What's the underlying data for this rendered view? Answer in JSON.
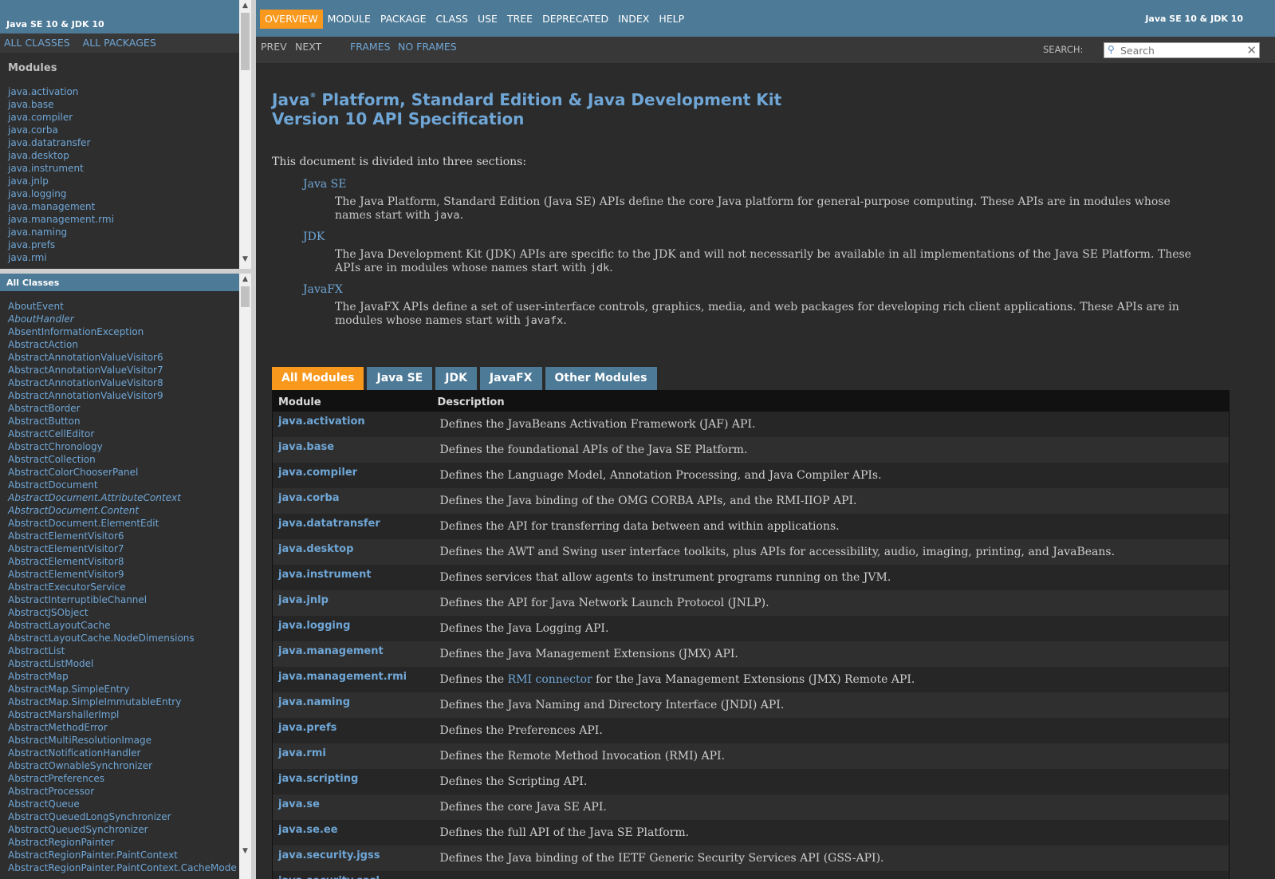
{
  "left_top": {
    "title": "Java SE 10 & JDK 10",
    "all_classes": "ALL CLASSES",
    "all_packages": "ALL PACKAGES",
    "heading": "Modules",
    "modules": [
      "java.activation",
      "java.base",
      "java.compiler",
      "java.corba",
      "java.datatransfer",
      "java.desktop",
      "java.instrument",
      "java.jnlp",
      "java.logging",
      "java.management",
      "java.management.rmi",
      "java.naming",
      "java.prefs",
      "java.rmi"
    ]
  },
  "left_bottom": {
    "title": "All Classes",
    "classes": [
      {
        "name": "AboutEvent",
        "italic": false
      },
      {
        "name": "AboutHandler",
        "italic": true
      },
      {
        "name": "AbsentInformationException",
        "italic": false
      },
      {
        "name": "AbstractAction",
        "italic": false
      },
      {
        "name": "AbstractAnnotationValueVisitor6",
        "italic": false
      },
      {
        "name": "AbstractAnnotationValueVisitor7",
        "italic": false
      },
      {
        "name": "AbstractAnnotationValueVisitor8",
        "italic": false
      },
      {
        "name": "AbstractAnnotationValueVisitor9",
        "italic": false
      },
      {
        "name": "AbstractBorder",
        "italic": false
      },
      {
        "name": "AbstractButton",
        "italic": false
      },
      {
        "name": "AbstractCellEditor",
        "italic": false
      },
      {
        "name": "AbstractChronology",
        "italic": false
      },
      {
        "name": "AbstractCollection",
        "italic": false
      },
      {
        "name": "AbstractColorChooserPanel",
        "italic": false
      },
      {
        "name": "AbstractDocument",
        "italic": false
      },
      {
        "name": "AbstractDocument.AttributeContext",
        "italic": true
      },
      {
        "name": "AbstractDocument.Content",
        "italic": true
      },
      {
        "name": "AbstractDocument.ElementEdit",
        "italic": false
      },
      {
        "name": "AbstractElementVisitor6",
        "italic": false
      },
      {
        "name": "AbstractElementVisitor7",
        "italic": false
      },
      {
        "name": "AbstractElementVisitor8",
        "italic": false
      },
      {
        "name": "AbstractElementVisitor9",
        "italic": false
      },
      {
        "name": "AbstractExecutorService",
        "italic": false
      },
      {
        "name": "AbstractInterruptibleChannel",
        "italic": false
      },
      {
        "name": "AbstractJSObject",
        "italic": false
      },
      {
        "name": "AbstractLayoutCache",
        "italic": false
      },
      {
        "name": "AbstractLayoutCache.NodeDimensions",
        "italic": false
      },
      {
        "name": "AbstractList",
        "italic": false
      },
      {
        "name": "AbstractListModel",
        "italic": false
      },
      {
        "name": "AbstractMap",
        "italic": false
      },
      {
        "name": "AbstractMap.SimpleEntry",
        "italic": false
      },
      {
        "name": "AbstractMap.SimpleImmutableEntry",
        "italic": false
      },
      {
        "name": "AbstractMarshallerImpl",
        "italic": false
      },
      {
        "name": "AbstractMethodError",
        "italic": false
      },
      {
        "name": "AbstractMultiResolutionImage",
        "italic": false
      },
      {
        "name": "AbstractNotificationHandler",
        "italic": false
      },
      {
        "name": "AbstractOwnableSynchronizer",
        "italic": false
      },
      {
        "name": "AbstractPreferences",
        "italic": false
      },
      {
        "name": "AbstractProcessor",
        "italic": false
      },
      {
        "name": "AbstractQueue",
        "italic": false
      },
      {
        "name": "AbstractQueuedLongSynchronizer",
        "italic": false
      },
      {
        "name": "AbstractQueuedSynchronizer",
        "italic": false
      },
      {
        "name": "AbstractRegionPainter",
        "italic": false
      },
      {
        "name": "AbstractRegionPainter.PaintContext",
        "italic": false
      },
      {
        "name": "AbstractRegionPainter.PaintContext.CacheMode",
        "italic": false
      }
    ]
  },
  "topnav": {
    "items": [
      "OVERVIEW",
      "MODULE",
      "PACKAGE",
      "CLASS",
      "USE",
      "TREE",
      "DEPRECATED",
      "INDEX",
      "HELP"
    ],
    "active": "OVERVIEW",
    "brand": "Java SE 10 & JDK 10"
  },
  "subnav": {
    "prev": "PREV",
    "next": "NEXT",
    "frames": "FRAMES",
    "no_frames": "NO FRAMES",
    "search_label": "SEARCH:",
    "search_placeholder": "Search"
  },
  "main": {
    "title_line1_pre": "Java",
    "title_reg": "®",
    "title_line1_post": " Platform, Standard Edition & Java Development Kit",
    "title_line2": "Version 10 API Specification",
    "intro": "This document is divided into three sections:",
    "sections": [
      {
        "term": "Java SE",
        "desc": "The Java Platform, Standard Edition (Java SE) APIs define the core Java platform for general-purpose computing. These APIs are in modules whose names start with ",
        "code": "java",
        "end": "."
      },
      {
        "term": "JDK",
        "desc": "The Java Development Kit (JDK) APIs are specific to the JDK and will not necessarily be available in all implementations of the Java SE Platform. These APIs are in modules whose names start with ",
        "code": "jdk",
        "end": "."
      },
      {
        "term": "JavaFX",
        "desc": "The JavaFX APIs define a set of user-interface controls, graphics, media, and web packages for developing rich client applications. These APIs are in modules whose names start with ",
        "code": "javafx",
        "end": "."
      }
    ],
    "tabs": [
      "All Modules",
      "Java SE",
      "JDK",
      "JavaFX",
      "Other Modules"
    ],
    "active_tab": "All Modules",
    "table_headers": {
      "module": "Module",
      "description": "Description"
    },
    "rows": [
      {
        "module": "java.activation",
        "desc": "Defines the JavaBeans Activation Framework (JAF) API."
      },
      {
        "module": "java.base",
        "desc": "Defines the foundational APIs of the Java SE Platform."
      },
      {
        "module": "java.compiler",
        "desc": "Defines the Language Model, Annotation Processing, and Java Compiler APIs."
      },
      {
        "module": "java.corba",
        "desc": "Defines the Java binding of the OMG CORBA APIs, and the RMI-IIOP API."
      },
      {
        "module": "java.datatransfer",
        "desc": "Defines the API for transferring data between and within applications."
      },
      {
        "module": "java.desktop",
        "desc": "Defines the AWT and Swing user interface toolkits, plus APIs for accessibility, audio, imaging, printing, and JavaBeans."
      },
      {
        "module": "java.instrument",
        "desc": "Defines services that allow agents to instrument programs running on the JVM."
      },
      {
        "module": "java.jnlp",
        "desc": "Defines the API for Java Network Launch Protocol (JNLP)."
      },
      {
        "module": "java.logging",
        "desc": "Defines the Java Logging API."
      },
      {
        "module": "java.management",
        "desc": "Defines the Java Management Extensions (JMX) API."
      },
      {
        "module": "java.management.rmi",
        "desc_pre": "Defines the ",
        "desc_link": "RMI connector",
        "desc_post": " for the Java Management Extensions (JMX) Remote API."
      },
      {
        "module": "java.naming",
        "desc": "Defines the Java Naming and Directory Interface (JNDI) API."
      },
      {
        "module": "java.prefs",
        "desc": "Defines the Preferences API."
      },
      {
        "module": "java.rmi",
        "desc": "Defines the Remote Method Invocation (RMI) API."
      },
      {
        "module": "java.scripting",
        "desc": "Defines the Scripting API."
      },
      {
        "module": "java.se",
        "desc": "Defines the core Java SE API."
      },
      {
        "module": "java.se.ee",
        "desc": "Defines the full API of the Java SE Platform."
      },
      {
        "module": "java.security.jgss",
        "desc": "Defines the Java binding of the IETF Generic Security Services API (GSS-API)."
      },
      {
        "module": "java.security.sasl",
        "desc": ""
      }
    ]
  },
  "colors": {
    "accent": "#f8981d",
    "header": "#4d7a97",
    "link": "#6fa6d6"
  }
}
